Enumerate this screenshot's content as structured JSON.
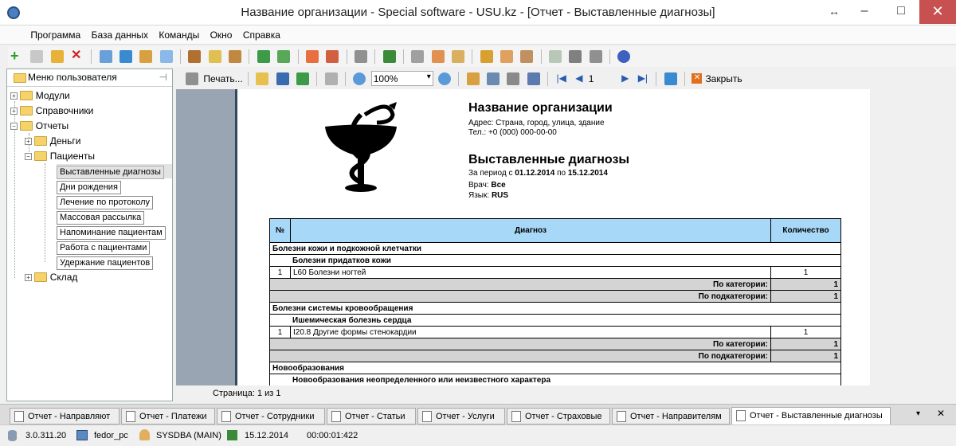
{
  "window": {
    "title": "Название организации - Special software - USU.kz - [Отчет - Выставленные диагнозы]"
  },
  "menu": [
    "Программа",
    "База данных",
    "Команды",
    "Окно",
    "Справка"
  ],
  "report_toolbar": {
    "print": "Печать...",
    "zoom": "100%",
    "page": "1",
    "close": "Закрыть"
  },
  "tree": {
    "header": "Меню пользователя",
    "items": [
      "Модули",
      "Справочники",
      "Отчеты",
      "Деньги",
      "Пациенты",
      "Выставленные диагнозы",
      "Дни рождения",
      "Лечение по протоколу",
      "Массовая рассылка",
      "Напоминание пациентам",
      "Работа с пациентами",
      "Удержание пациентов",
      "Склад"
    ]
  },
  "report": {
    "org": "Название организации",
    "address": "Адрес: Страна, город, улица, здание",
    "phone": "Тел.: +0 (000) 000-00-00",
    "title": "Выставленные диагнозы",
    "period_prefix": "За период с ",
    "date_from": "01.12.2014",
    "period_mid": " по ",
    "date_to": "15.12.2014",
    "doctor_label": "Врач: ",
    "doctor": "Все",
    "lang_label": "Язык: ",
    "lang": "RUS",
    "cols": [
      "№",
      "Диагноз",
      "Количество"
    ],
    "rows": {
      "cat1": "Болезни кожи и подкожной клетчатки",
      "sub1": "Болезни придатков кожи",
      "r1n": "1",
      "r1d": "L60 Болезни ногтей",
      "r1q": "1",
      "by_cat": "По категории:",
      "by_sub": "По подкатегории:",
      "s1a": "1",
      "s1b": "1",
      "cat2": "Болезни системы кровообращения",
      "sub2": "Ишемическая болезнь сердца",
      "r2n": "1",
      "r2d": "I20.8 Другие формы стенокардии",
      "r2q": "1",
      "s2a": "1",
      "s2b": "1",
      "cat3": "Новообразования",
      "sub3": "Новообразования неопределенного или неизвестного характера"
    }
  },
  "page_status": "Страница: 1 из 1",
  "tabs": [
    "Отчет - Направляют",
    "Отчет - Платежи",
    "Отчет - Сотрудники",
    "Отчет - Статьи",
    "Отчет - Услуги",
    "Отчет - Страховые",
    "Отчет - Направителям",
    "Отчет - Выставленные диагнозы"
  ],
  "status": {
    "version": "3.0.311.20",
    "pc": "fedor_pc",
    "user": "SYSDBA (MAIN)",
    "date": "15.12.2014",
    "time": "00:00:01:422"
  }
}
